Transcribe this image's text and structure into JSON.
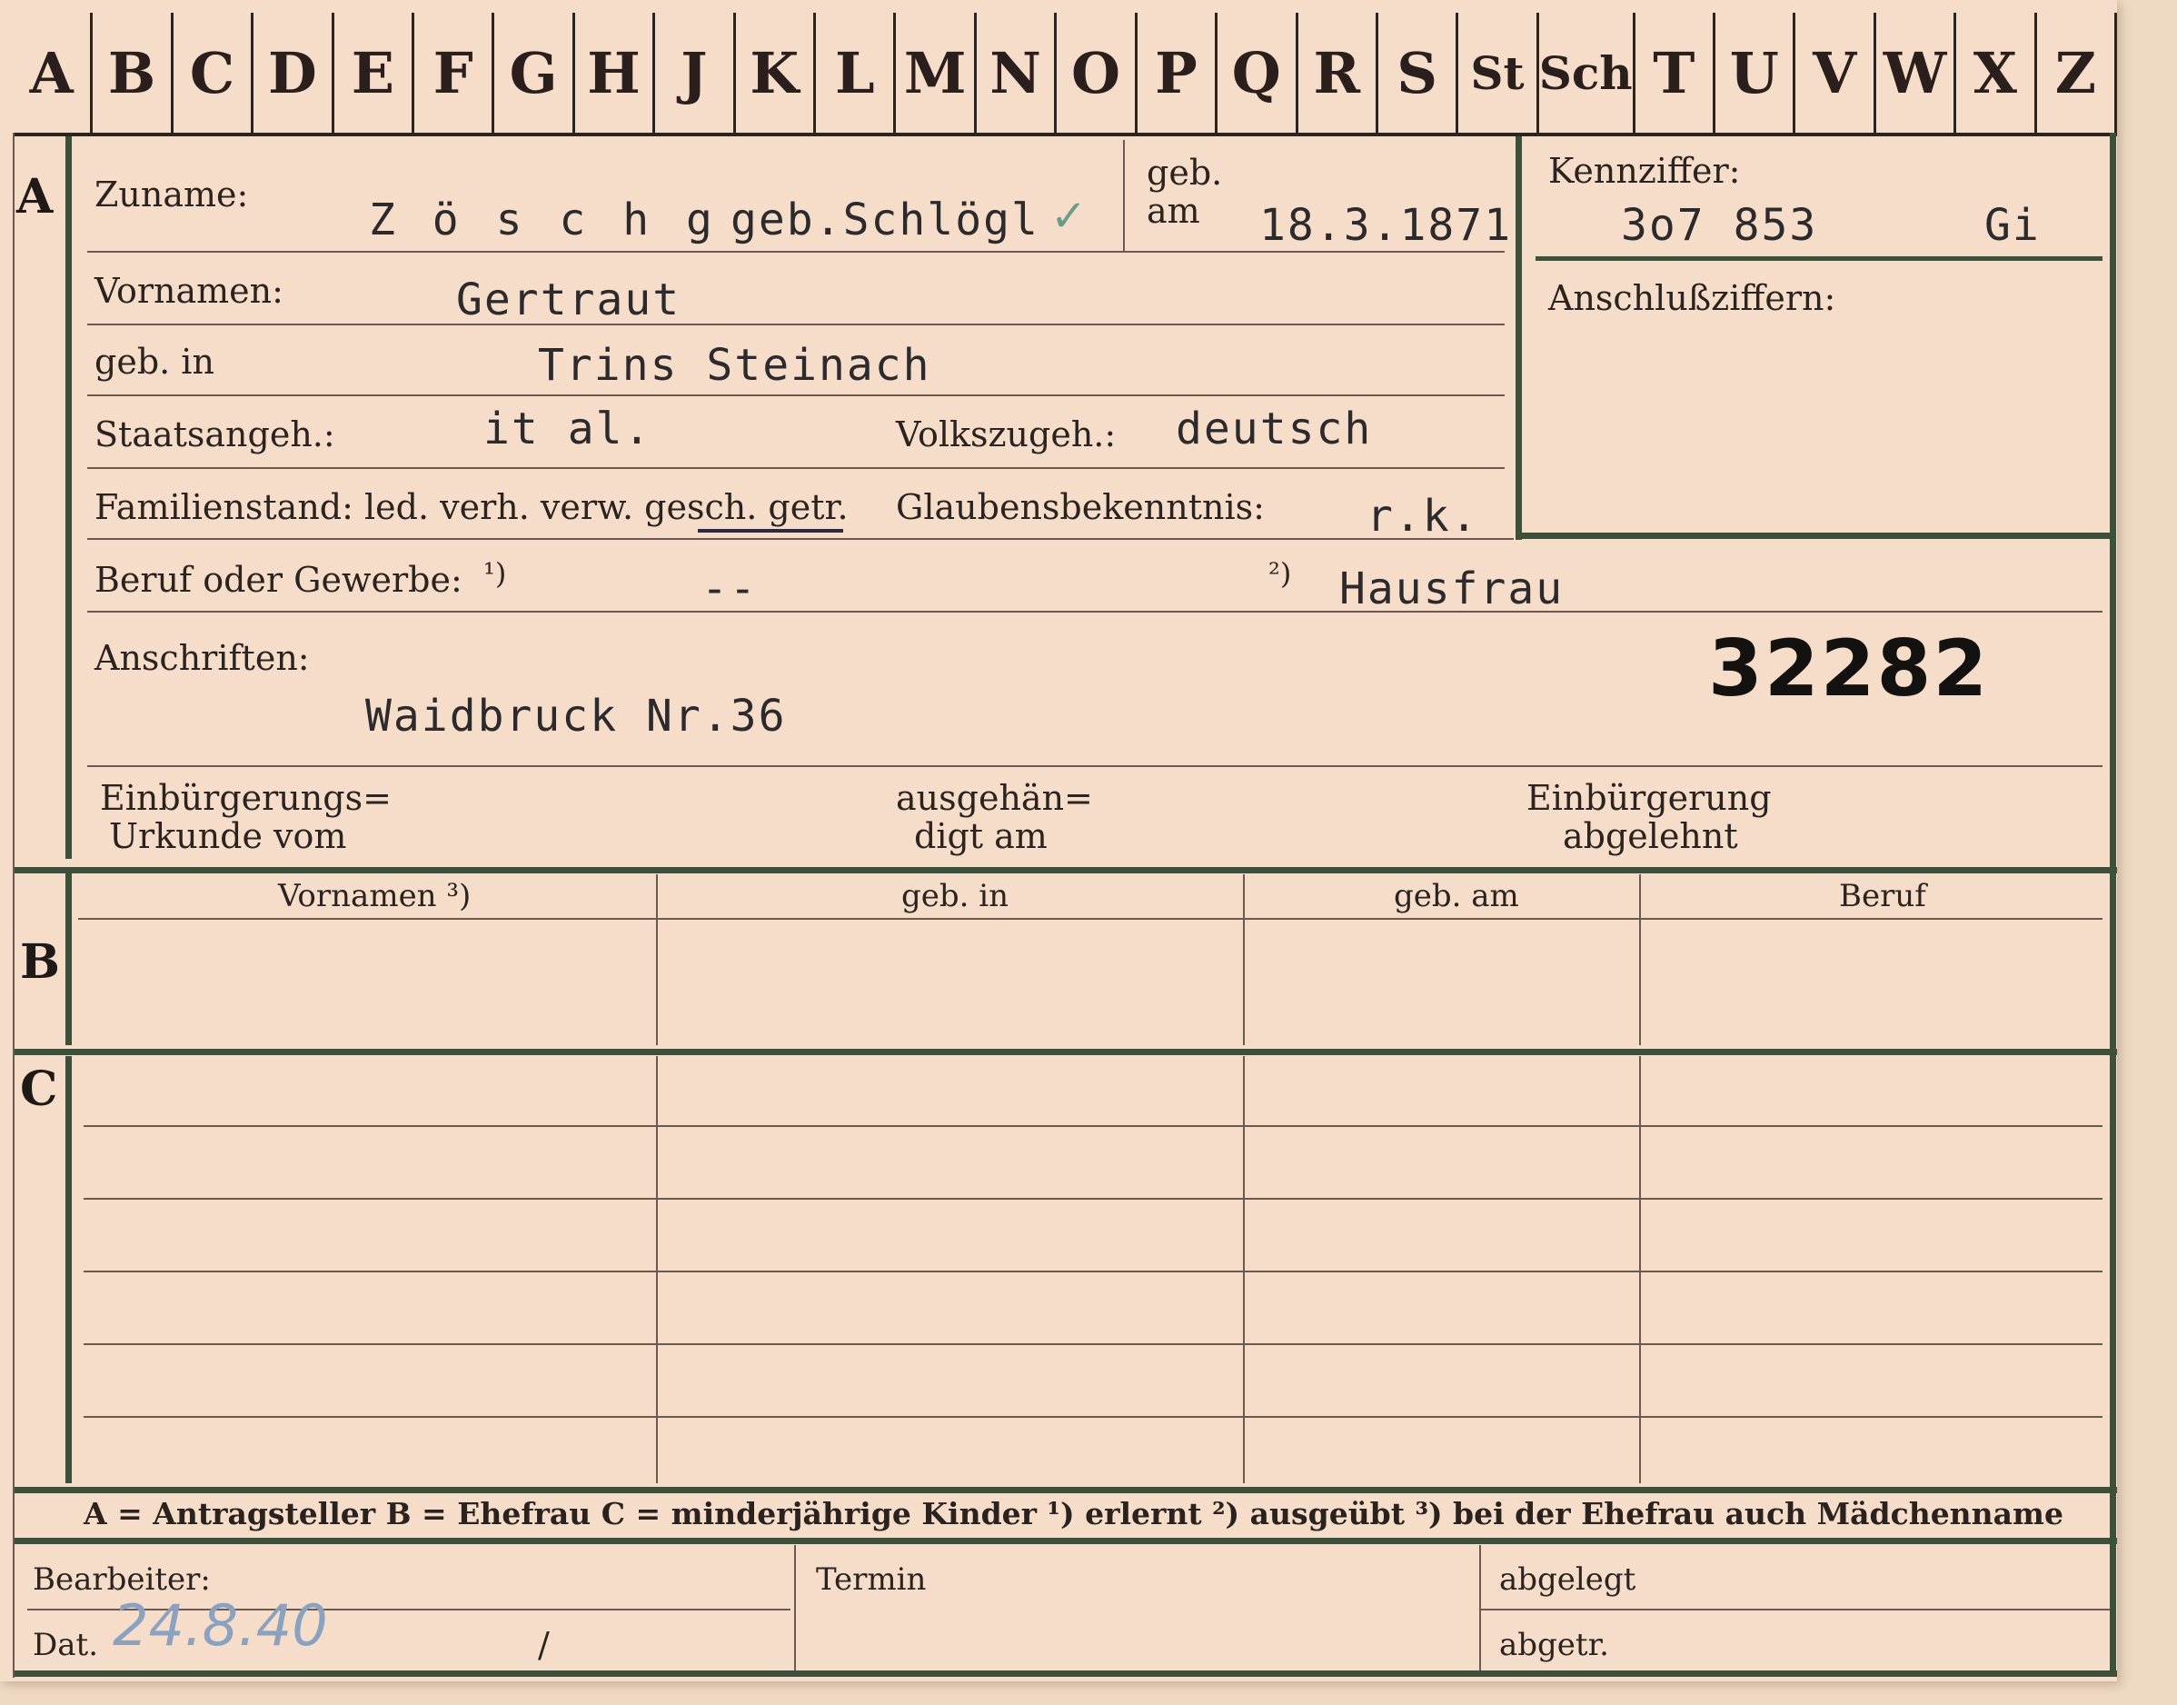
{
  "tabs": [
    "A",
    "B",
    "C",
    "D",
    "E",
    "F",
    "G",
    "H",
    "J",
    "K",
    "L",
    "M",
    "N",
    "O",
    "P",
    "Q",
    "R",
    "S",
    "St",
    "Sch",
    "T",
    "U",
    "V",
    "W",
    "X",
    "Z"
  ],
  "section_a": {
    "letter": "A",
    "zuname_label": "Zuname:",
    "zuname_value": "Z ö s c h g",
    "zuname_geb": "geb.Schlögl",
    "check_mark": "✓",
    "geb_am_label_1": "geb.",
    "geb_am_label_2": "am",
    "geb_am_value": "18.3.1871",
    "kennziffer_label": "Kennziffer:",
    "kennziffer_value": "3o7 853",
    "kennziffer_suffix": "Gi",
    "anschluss_label": "Anschlußziffern:",
    "vornamen_label": "Vornamen:",
    "vornamen_value": "Gertraut",
    "geb_in_label": "geb. in",
    "geb_in_value": "Trins Steinach",
    "staatsangeh_label": "Staatsangeh.:",
    "staatsangeh_value": "it al.",
    "volkszugeh_label": "Volkszugeh.:",
    "volkszugeh_value": "deutsch",
    "familienstand_label": "Familienstand: led. verh. verw. gesch. getr.",
    "glaubens_label": "Glaubensbekenntnis:",
    "glaubens_value": "r.k.",
    "beruf_label": "Beruf oder Gewerbe:",
    "beruf_note1": "¹)",
    "beruf_value1": "--",
    "beruf_note2": "²)",
    "beruf_value2": "Hausfrau",
    "anschriften_label": "Anschriften:",
    "anschriften_value": "Waidbruck  Nr.36",
    "stamp_number": "32282",
    "einbuergerung_label_1": "Einbürgerungs=",
    "einbuergerung_label_2": "Urkunde vom",
    "ausgehaen_label_1": "ausgehän=",
    "ausgehaen_label_2": "digt am",
    "abgelehnt_label_1": "Einbürgerung",
    "abgelehnt_label_2": "abgelehnt"
  },
  "section_b": {
    "letter": "B",
    "headers": [
      "Vornamen ³)",
      "geb. in",
      "geb. am",
      "Beruf"
    ]
  },
  "section_c": {
    "letter": "C"
  },
  "legend": "A = Antragsteller   B = Ehefrau   C = minderjährige Kinder  ¹) erlernt   ²) ausgeübt   ³) bei der Ehefrau auch Mädchenname",
  "footer": {
    "bearbeiter_label": "Bearbeiter:",
    "dat_label": "Dat.",
    "dat_value": "24.8.40",
    "dat_slash": "/",
    "termin_label": "Termin",
    "abgelegt_label": "abgelegt",
    "abgetr_label": "abgetr."
  }
}
